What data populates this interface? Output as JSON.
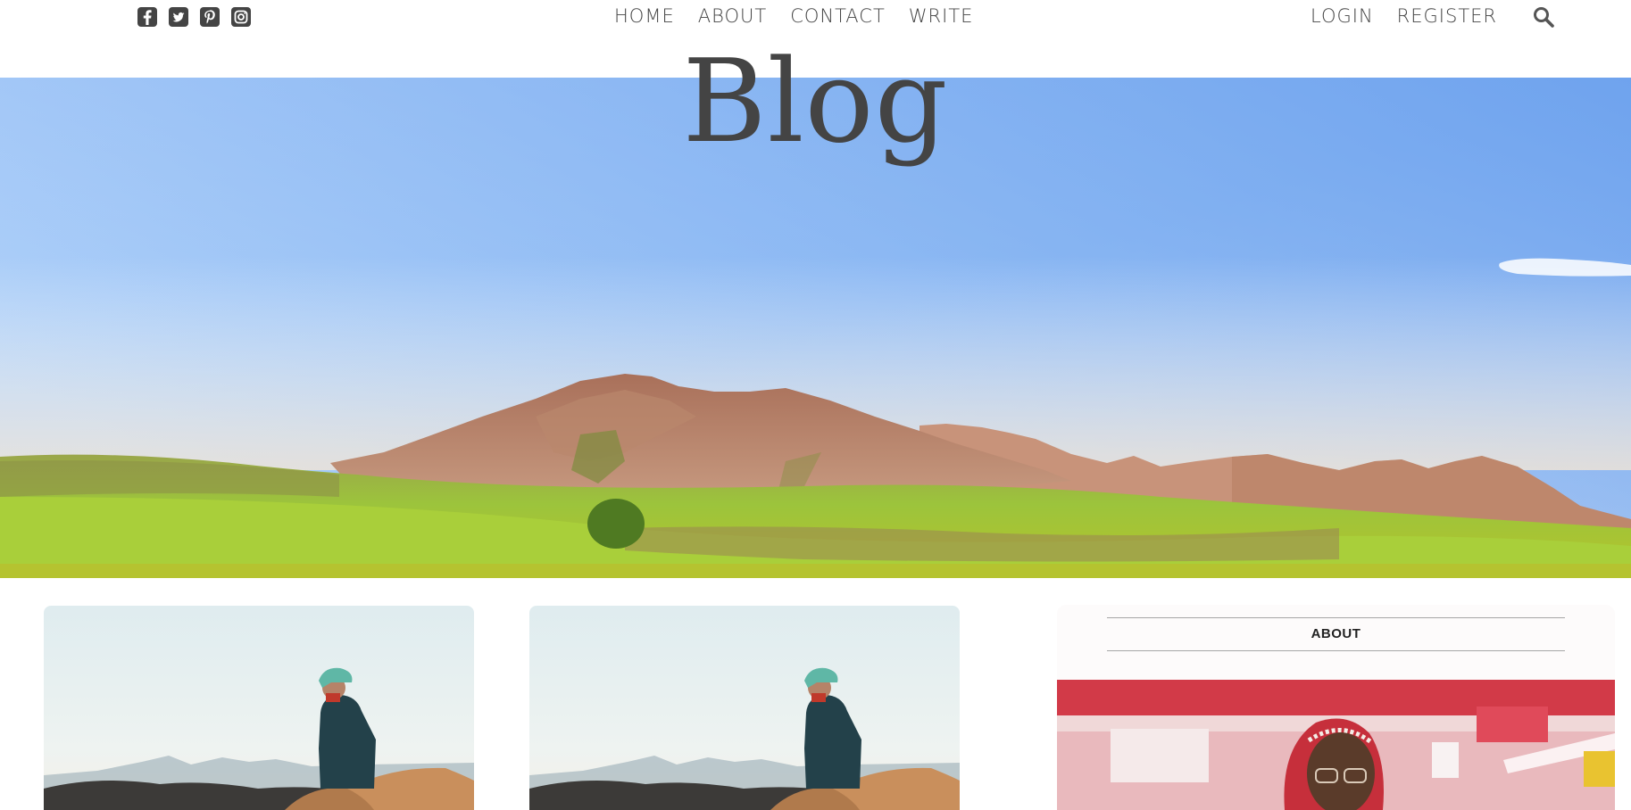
{
  "header": {
    "social_icons": [
      "facebook-square-icon",
      "twitter-square-icon",
      "pinterest-square-icon",
      "instagram-square-icon"
    ],
    "nav_center": [
      {
        "label": "HOME"
      },
      {
        "label": "ABOUT"
      },
      {
        "label": "CONTACT"
      },
      {
        "label": "WRITE"
      }
    ],
    "nav_right": [
      {
        "label": "LOGIN"
      },
      {
        "label": "REGISTER"
      }
    ],
    "search_icon": "search-icon"
  },
  "hero": {
    "title": "Blog",
    "image": "mountain-landscape-image"
  },
  "posts": [
    {
      "image": "person-on-dunes-image"
    },
    {
      "image": "person-on-dunes-image"
    }
  ],
  "sidebar": {
    "title": "ABOUT",
    "image": "woman-portrait-image"
  },
  "colors": {
    "text": "#444444",
    "sky_top": "#7fb2f0",
    "mountain": "#b07a5e",
    "grass": "#8fb83a"
  }
}
